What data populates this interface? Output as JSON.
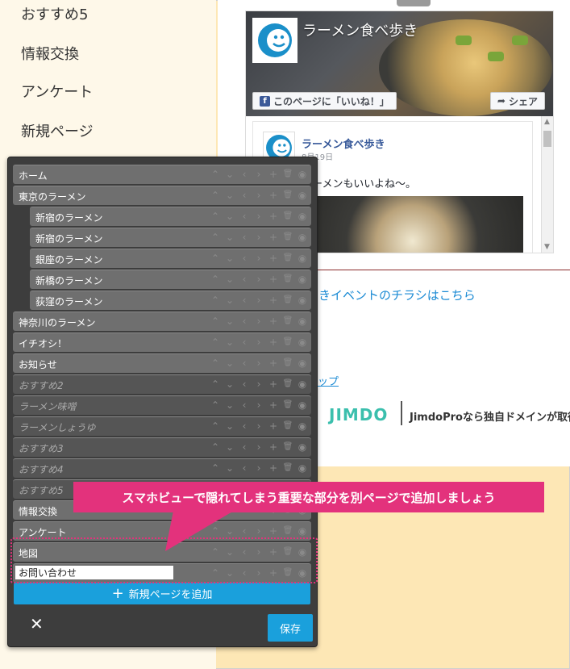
{
  "sidebar": {
    "items": [
      "おすすめ5",
      "情報交換",
      "アンケート",
      "新規ページ"
    ]
  },
  "facebook": {
    "page_name": "ラーメン食べ歩き",
    "like_label": "このページに「いいね！」",
    "share_label": "シェア",
    "post_author": "ラーメン食べ歩き",
    "post_date": "8月19日",
    "post_text": "ラーメンもいいよね〜。"
  },
  "content": {
    "event_link": "きイベントのチラシはこちら",
    "link_text": "ップ",
    "jimdo_logo": "JIMDO",
    "jimdo_text": "JimdoProなら独自ドメインが取得で"
  },
  "nav_editor": {
    "rows": [
      {
        "label": "ホーム",
        "level": 0,
        "hidden": false
      },
      {
        "label": "東京のラーメン",
        "level": 0,
        "hidden": false
      },
      {
        "label": "新宿のラーメン",
        "level": 1,
        "hidden": false
      },
      {
        "label": "新宿のラーメン",
        "level": 1,
        "hidden": false
      },
      {
        "label": "銀座のラーメン",
        "level": 1,
        "hidden": false
      },
      {
        "label": "新橋のラーメン",
        "level": 1,
        "hidden": false
      },
      {
        "label": "荻窪のラーメン",
        "level": 1,
        "hidden": false
      },
      {
        "label": "神奈川のラーメン",
        "level": 0,
        "hidden": false
      },
      {
        "label": "イチオシ！",
        "level": 0,
        "hidden": false
      },
      {
        "label": "お知らせ",
        "level": 0,
        "hidden": false
      },
      {
        "label": "おすすめ2",
        "level": 0,
        "hidden": true
      },
      {
        "label": "ラーメン味噌",
        "level": 0,
        "hidden": true
      },
      {
        "label": "ラーメンしょうゆ",
        "level": 0,
        "hidden": true
      },
      {
        "label": "おすすめ3",
        "level": 0,
        "hidden": true
      },
      {
        "label": "おすすめ4",
        "level": 0,
        "hidden": true
      },
      {
        "label": "おすすめ5",
        "level": 0,
        "hidden": true
      },
      {
        "label": "情報交換",
        "level": 0,
        "hidden": false
      },
      {
        "label": "アンケート",
        "level": 0,
        "hidden": false
      },
      {
        "label": "地図",
        "level": 0,
        "hidden": false
      },
      {
        "label": "お問い合わせ",
        "level": 0,
        "hidden": false,
        "editing": true
      }
    ],
    "add_button_label": "新規ページを追加",
    "add_icon": "+",
    "close_icon": "✕",
    "save_label": "保存"
  },
  "annotation": {
    "callout_text": "スマホビューで隠れてしまう重要な部分を別ページで追加しましょう",
    "color": "#e3327c"
  },
  "colors": {
    "accent_blue": "#1aa0dc",
    "background": "#fde7b5",
    "fb_blue": "#365899"
  }
}
